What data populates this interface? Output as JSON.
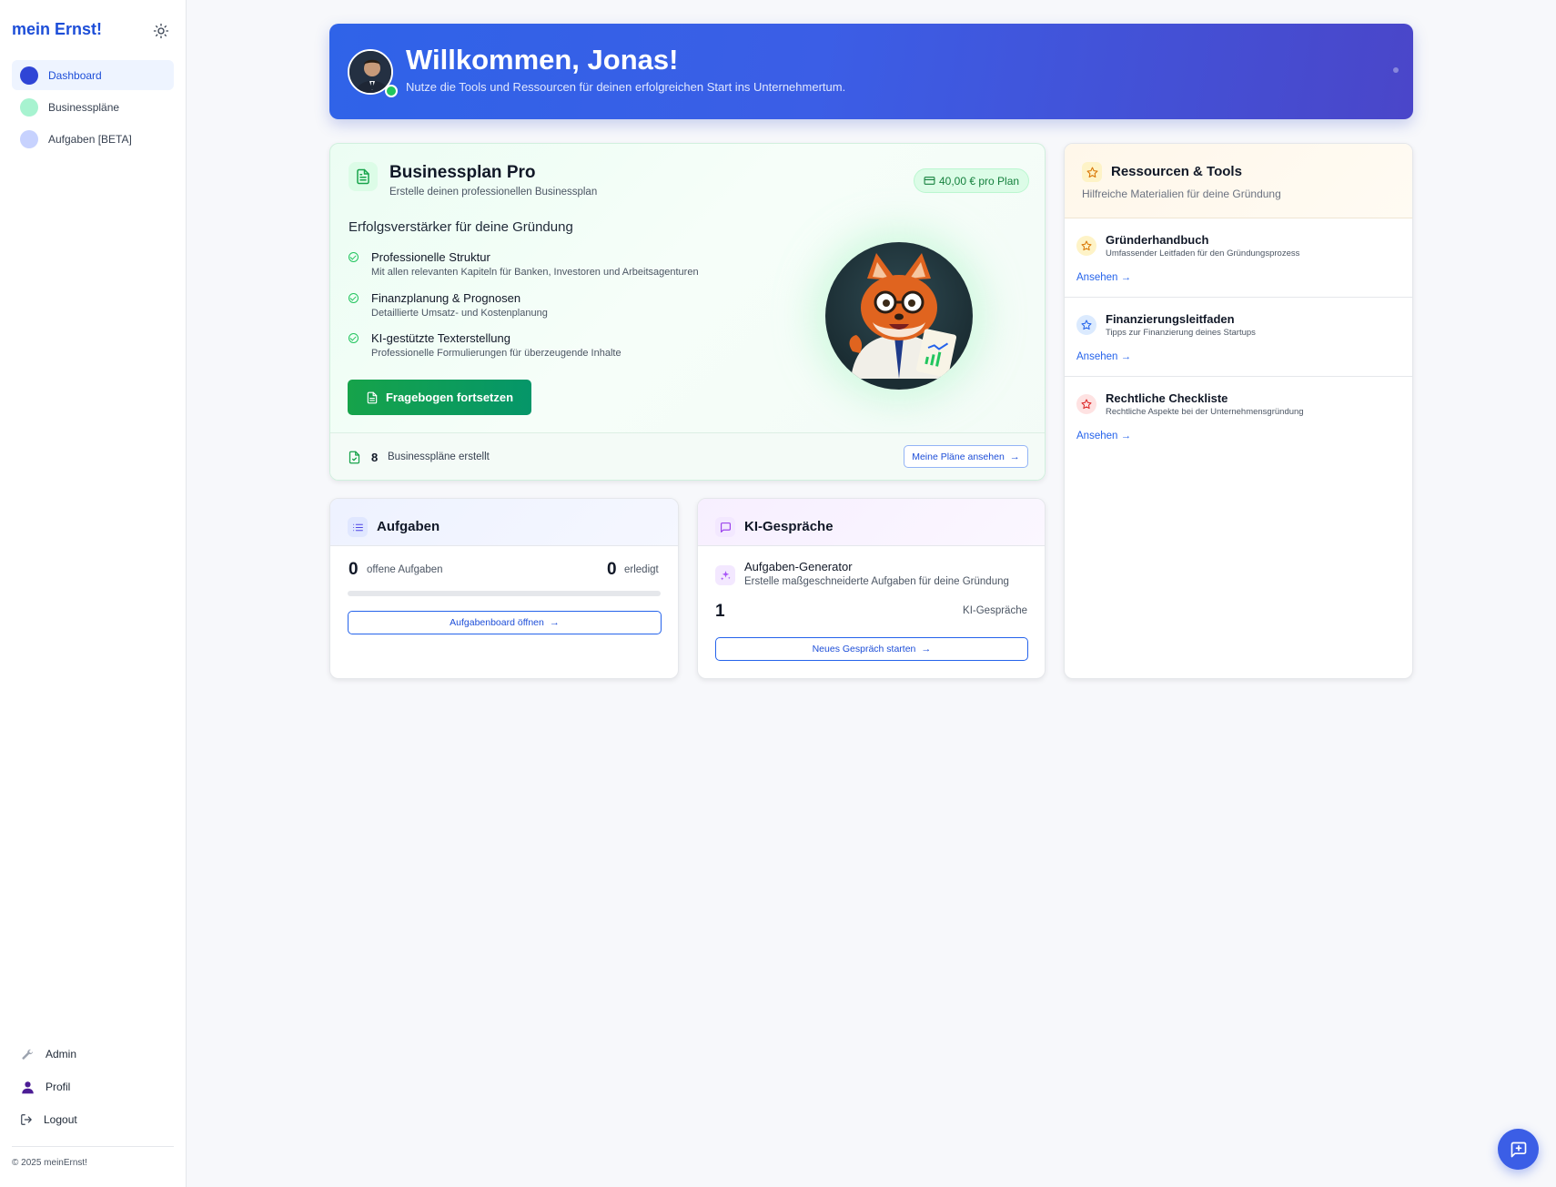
{
  "sidebar": {
    "brand": "mein Ernst!",
    "items": [
      {
        "label": "Dashboard",
        "color": "#2f45d6",
        "active": true
      },
      {
        "label": "Businesspläne",
        "color": "#a7f3d0"
      },
      {
        "label": "Aufgaben [BETA]",
        "color": "#c7d2fe"
      }
    ],
    "bottom": {
      "admin": "Admin",
      "profile": "Profil",
      "logout": "Logout"
    },
    "copyright": "© 2025 meinErnst!"
  },
  "hero": {
    "title": "Willkommen, Jonas!",
    "subtitle": "Nutze die Tools und Ressourcen für deinen erfolgreichen Start ins Unternehmertum."
  },
  "businessplan": {
    "title": "Businessplan Pro",
    "subtitle": "Erstelle deinen professionellen Businessplan",
    "price": "40,00 € pro Plan",
    "heading": "Erfolgsverstärker für deine Gründung",
    "features": [
      {
        "title": "Professionelle Struktur",
        "desc": "Mit allen relevanten Kapiteln für Banken, Investoren und Arbeitsagenturen"
      },
      {
        "title": "Finanzplanung & Prognosen",
        "desc": "Detaillierte Umsatz- und Kostenplanung"
      },
      {
        "title": "KI-gestützte Texterstellung",
        "desc": "Professionelle Formulierungen für überzeugende Inhalte"
      }
    ],
    "cta": "Fragebogen fortsetzen",
    "count": "8",
    "count_label": "Businesspläne erstellt",
    "plans_button": "Meine Pläne ansehen"
  },
  "resources": {
    "title": "Ressourcen & Tools",
    "subtitle": "Hilfreiche Materialien für deine Gründung",
    "items": [
      {
        "title": "Gründerhandbuch",
        "desc": "Umfassender Leitfaden für den Gründungsprozess",
        "link": "Ansehen →",
        "color": "#d97706",
        "bg": "#fef3c7"
      },
      {
        "title": "Finanzierungsleitfaden",
        "desc": "Tipps zur Finanzierung deines Startups",
        "link": "Ansehen →",
        "color": "#2563eb",
        "bg": "#dbeafe"
      },
      {
        "title": "Rechtliche Checkliste",
        "desc": "Rechtliche Aspekte bei der Unternehmensgründung",
        "link": "Ansehen →",
        "color": "#dc2626",
        "bg": "#fee2e2"
      }
    ]
  },
  "tasks": {
    "title": "Aufgaben",
    "open_count": "0",
    "open_label": "offene Aufgaben",
    "done_count": "0",
    "done_label": "erledigt",
    "progress": 0,
    "button": "Aufgabenboard öffnen"
  },
  "ai": {
    "title": "KI-Gespräche",
    "generator_title": "Aufgaben-Generator",
    "generator_desc": "Erstelle maßgeschneiderte Aufgaben für deine Gründung",
    "count": "1",
    "count_label": "KI-Gespräche",
    "button": "Neues Gespräch starten"
  }
}
